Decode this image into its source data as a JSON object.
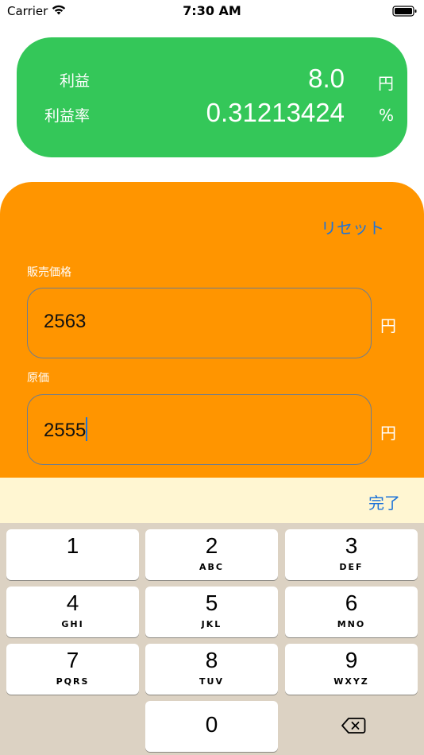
{
  "status_bar": {
    "carrier": "Carrier",
    "time": "7:30 AM"
  },
  "result": {
    "profit_label": "利益",
    "profit_value": "8.0",
    "profit_unit": "円",
    "rate_label": "利益率",
    "rate_value": "0.31213424",
    "rate_unit": "%"
  },
  "form": {
    "reset_label": "リセット",
    "selling_price_label": "販売価格",
    "selling_price_value": "2563",
    "selling_price_unit": "円",
    "cost_label": "原価",
    "cost_value": "2555",
    "cost_unit": "円"
  },
  "toolbar": {
    "done_label": "完了"
  },
  "keypad": {
    "keys": [
      {
        "number": "1",
        "letters": ""
      },
      {
        "number": "2",
        "letters": "ABC"
      },
      {
        "number": "3",
        "letters": "DEF"
      },
      {
        "number": "4",
        "letters": "GHI"
      },
      {
        "number": "5",
        "letters": "JKL"
      },
      {
        "number": "6",
        "letters": "MNO"
      },
      {
        "number": "7",
        "letters": "PQRS"
      },
      {
        "number": "8",
        "letters": "TUV"
      },
      {
        "number": "9",
        "letters": "WXYZ"
      },
      {
        "number": "0",
        "letters": ""
      }
    ],
    "delete_icon": "backspace-icon"
  },
  "colors": {
    "result_card": "#34c759",
    "input_panel": "#ff9500",
    "accent_blue": "#1f74d8",
    "toolbar": "#fff6d2",
    "keyboard": "#dcd2c3"
  }
}
